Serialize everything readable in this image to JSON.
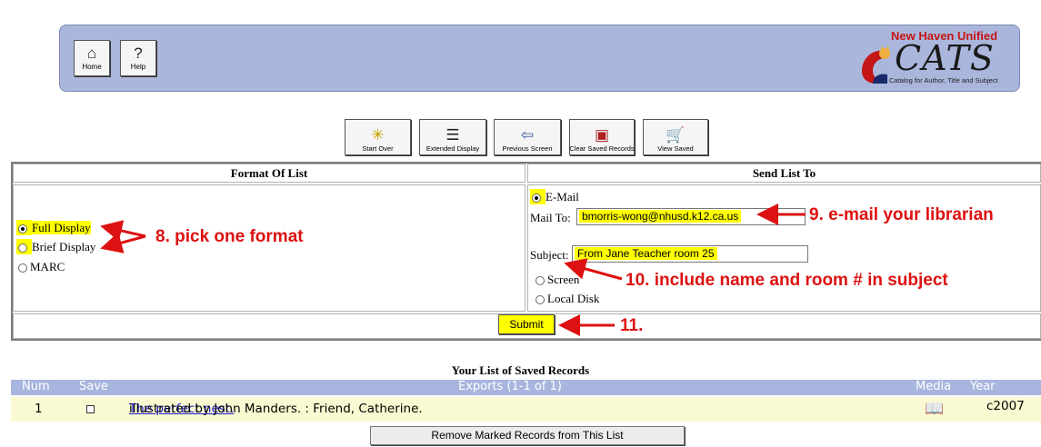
{
  "nav": {
    "home_label": "Home",
    "help_label": "Help"
  },
  "logo": {
    "district": "New Haven Unified",
    "name": "CATS",
    "tagline": "Catalog for Author, Title and Subject"
  },
  "toolbar": {
    "start_over": "Start Over",
    "extended_display": "Extended Display",
    "previous_screen": "Previous Screen",
    "clear_saved": "Clear Saved Records",
    "view_saved": "View Saved"
  },
  "format": {
    "header": "Format Of List",
    "options": [
      {
        "label": "Full Display",
        "selected": true
      },
      {
        "label": "Brief Display",
        "selected": false
      },
      {
        "label": "MARC",
        "selected": false
      }
    ]
  },
  "send": {
    "header": "Send List To",
    "email_label": "E-Mail",
    "mail_to_label": "Mail To:",
    "mail_to_value": "bmorris-wong@nhusd.k12.ca.us",
    "subject_label": "Subject:",
    "subject_value": "From Jane Teacher room 25",
    "screen_label": "Screen",
    "local_disk_label": "Local Disk"
  },
  "submit_label": "Submit",
  "annotations": {
    "a8": "8. pick one format",
    "a9": "9. e-mail your librarian",
    "a10": "10. include name and room # in subject",
    "a11": "11."
  },
  "records": {
    "title": "Your List of Saved Records",
    "columns": {
      "num": "Num",
      "save": "Save",
      "exports": "Exports (1-1 of 1)",
      "media": "Media",
      "year": "Year"
    },
    "rows": [
      {
        "num": "1",
        "title_link": "The perfect nest.",
        "details": " illustrated by John Manders. : Friend, Catherine.",
        "media_icon": "book-icon",
        "year": "c2007"
      }
    ],
    "remove_label": "Remove Marked Records from This List"
  },
  "colors": {
    "banner": "#aab6dc",
    "highlight": "#ffff00",
    "annotation": "#dd1111",
    "row_bg": "#fafad2"
  }
}
